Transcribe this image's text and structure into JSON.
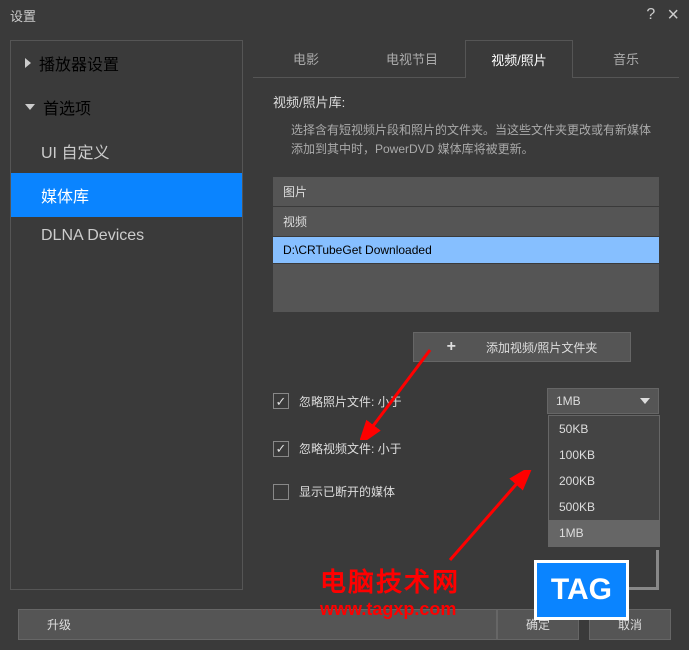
{
  "titlebar": {
    "title": "设置"
  },
  "sidebar": {
    "sections": [
      {
        "label": "播放器设置"
      },
      {
        "label": "首选项"
      }
    ],
    "items": [
      {
        "label": "UI 自定义"
      },
      {
        "label": "媒体库"
      },
      {
        "label": "DLNA Devices"
      }
    ]
  },
  "tabs": [
    {
      "label": "电影"
    },
    {
      "label": "电视节目"
    },
    {
      "label": "视频/照片"
    },
    {
      "label": "音乐"
    }
  ],
  "panel": {
    "section_title": "视频/照片库:",
    "description": "选择含有短视频片段和照片的文件夹。当这些文件夹更改或有新媒体添加到其中时，PowerDVD 媒体库将被更新。",
    "folders": [
      {
        "label": "图片"
      },
      {
        "label": "视频"
      },
      {
        "label": "D:\\CRTubeGet Downloaded"
      }
    ],
    "add_button": "添加视频/照片文件夹",
    "options": [
      {
        "label": "忽略照片文件: 小于",
        "checked": true,
        "select_value": "1MB"
      },
      {
        "label": "忽略视频文件: 小于",
        "checked": true,
        "select_value": ""
      },
      {
        "label": "显示已断开的媒体",
        "checked": false
      }
    ],
    "dropdown_options": [
      "50KB",
      "100KB",
      "200KB",
      "500KB",
      "1MB"
    ]
  },
  "footer": {
    "upgrade": "升级",
    "ok": "确定",
    "cancel": "取消"
  },
  "watermark": {
    "line1": "电脑技术网",
    "line2": "www.tagxp.com",
    "tag": "TAG"
  }
}
